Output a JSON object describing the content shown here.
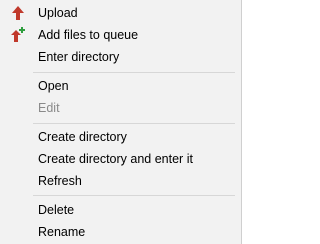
{
  "context_menu": {
    "items": [
      {
        "label": "Upload",
        "icon": "upload-arrow-icon",
        "enabled": true
      },
      {
        "label": "Add files to queue",
        "icon": "add-to-queue-icon",
        "enabled": true
      },
      {
        "label": "Enter directory",
        "enabled": true
      },
      {
        "label": "Open",
        "enabled": true
      },
      {
        "label": "Edit",
        "enabled": false
      },
      {
        "label": "Create directory",
        "enabled": true
      },
      {
        "label": "Create directory and enter it",
        "enabled": true
      },
      {
        "label": "Refresh",
        "enabled": true
      },
      {
        "label": "Delete",
        "enabled": true
      },
      {
        "label": "Rename",
        "enabled": true
      }
    ]
  },
  "colors": {
    "menu_background": "#f2f2f2",
    "upload_arrow": "#c0392b",
    "queue_plus": "#2e9e3e",
    "disabled_text": "#8a8a8a",
    "separator": "#d7d7d7"
  }
}
